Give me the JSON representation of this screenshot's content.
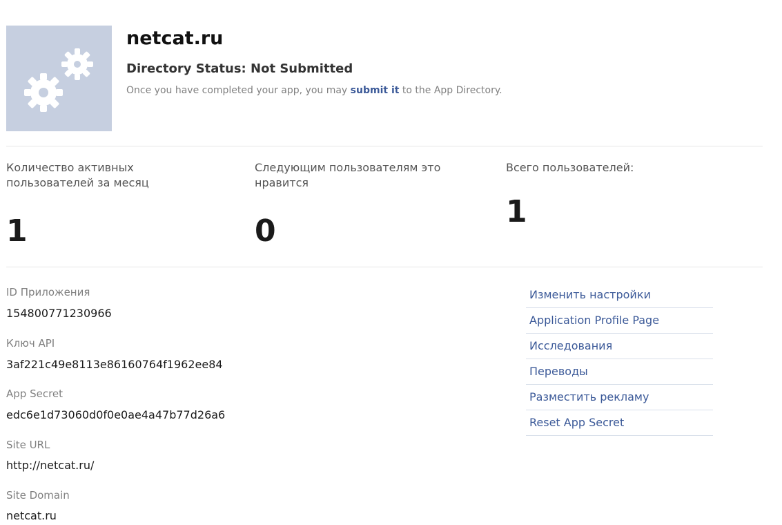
{
  "header": {
    "icon": "gears-icon",
    "app_name": "netcat.ru",
    "directory_status": "Directory Status: Not Submitted",
    "hint_before": "Once you have completed your app, you may ",
    "hint_link": "submit it",
    "hint_after": " to the App Directory."
  },
  "stats": [
    {
      "label": "Количество активных пользователей за месяц",
      "value": "1"
    },
    {
      "label": "Следующим пользователям это нравится",
      "value": "0"
    },
    {
      "label": "Всего пользователей:",
      "value": "1"
    }
  ],
  "info": [
    {
      "label": "ID Приложения",
      "value": "154800771230966"
    },
    {
      "label": "Ключ API",
      "value": "3af221c49e8113e86160764f1962ee84"
    },
    {
      "label": "App Secret",
      "value": "edc6e1d73060d0f0e0ae4a47b77d26a6"
    },
    {
      "label": "Site URL",
      "value": "http://netcat.ru/"
    },
    {
      "label": "Site Domain",
      "value": "netcat.ru"
    }
  ],
  "side_links": [
    "Изменить настройки",
    "Application Profile Page",
    "Исследования",
    "Переводы",
    "Разместить рекламу",
    "Reset App Secret"
  ],
  "colors": {
    "link": "#3b5998",
    "icon_bg": "#c6cfe0",
    "divider": "#e6e6e6"
  }
}
